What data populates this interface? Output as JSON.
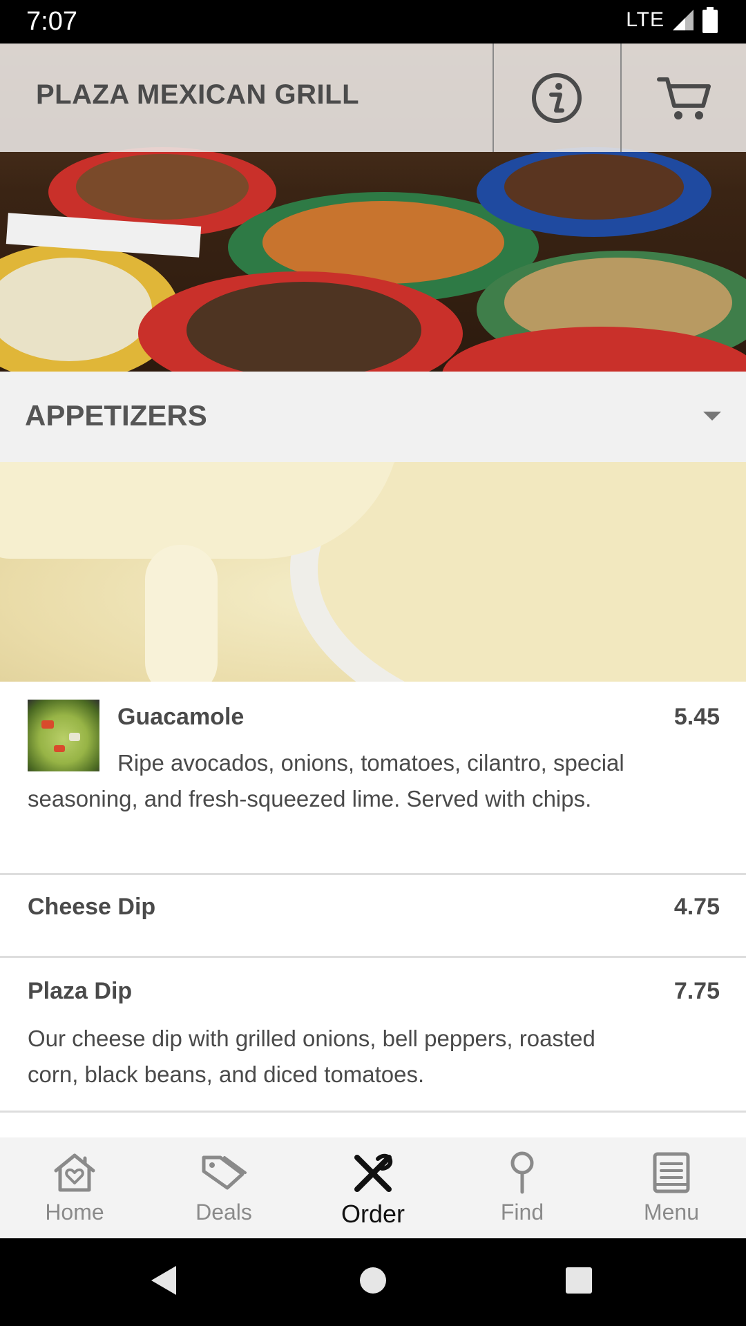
{
  "status_bar": {
    "time": "7:07",
    "network": "LTE"
  },
  "header": {
    "title": "PLAZA MEXICAN GRILL",
    "info_icon": "info-icon",
    "cart_icon": "cart-icon"
  },
  "category": {
    "title": "APPETIZERS",
    "caret_icon": "dropdown-caret-icon"
  },
  "items": [
    {
      "name": "Guacamole",
      "price": "5.45",
      "description": "Ripe avocados, onions, tomatoes, cilantro, special seasoning, and fresh-squeezed lime. Served with chips."
    },
    {
      "name": "Cheese Dip",
      "price": "4.75",
      "description": ""
    },
    {
      "name": "Plaza Dip",
      "price": "7.75",
      "description": "Our cheese dip with grilled onions, bell peppers, roasted corn, black beans, and diced tomatoes."
    }
  ],
  "bottom_nav": [
    {
      "label": "Home",
      "icon": "home-heart-icon",
      "active": false
    },
    {
      "label": "Deals",
      "icon": "tag-icon",
      "active": false
    },
    {
      "label": "Order",
      "icon": "utensils-icon",
      "active": true
    },
    {
      "label": "Find",
      "icon": "location-pin-icon",
      "active": false
    },
    {
      "label": "Menu",
      "icon": "book-icon",
      "active": false
    }
  ],
  "system_nav": {
    "back": "back-icon",
    "home": "home-circle-icon",
    "recents": "recents-square-icon"
  }
}
